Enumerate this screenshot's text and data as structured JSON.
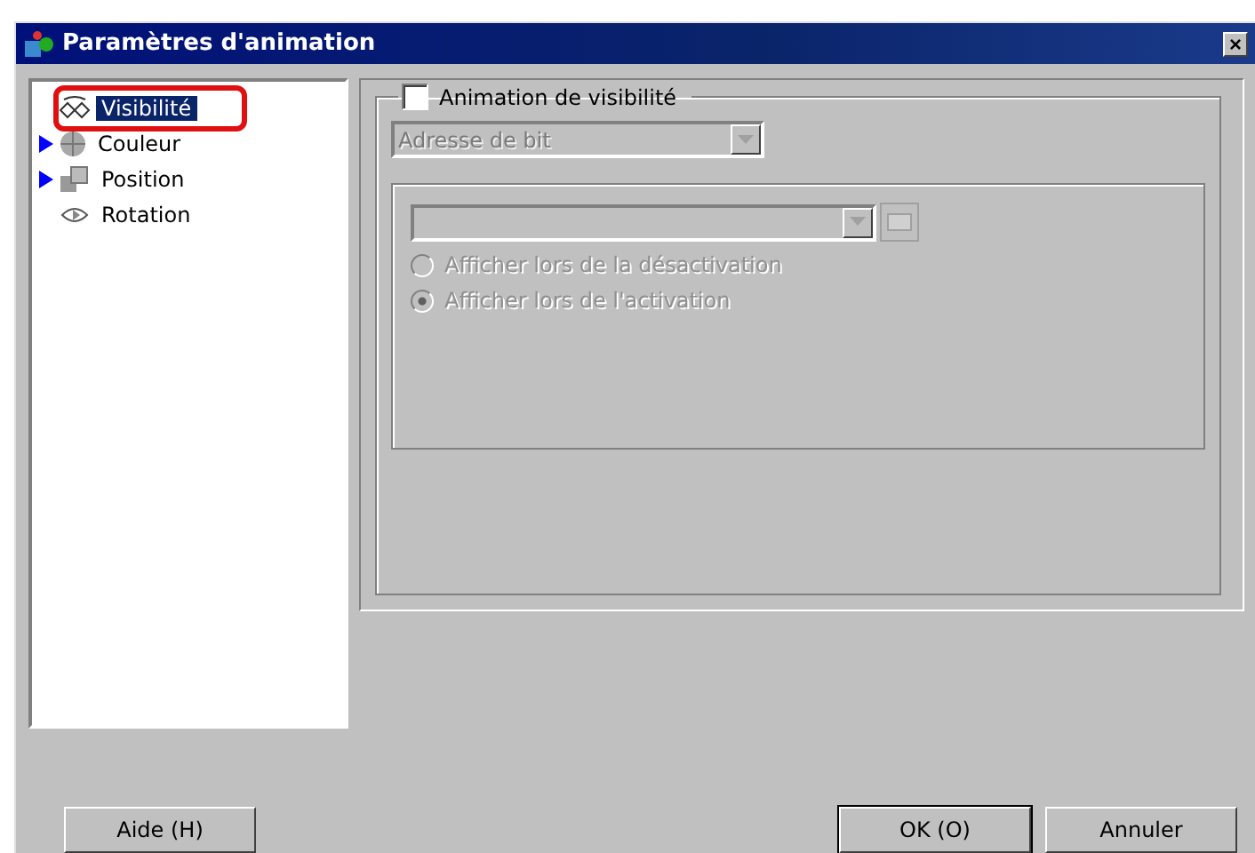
{
  "window": {
    "title": "Paramètres d'animation",
    "close": "×"
  },
  "tree": {
    "items": [
      {
        "label": "Visibilité",
        "selected": true,
        "expandable": false,
        "highlighted": true
      },
      {
        "label": "Couleur",
        "selected": false,
        "expandable": true,
        "highlighted": false
      },
      {
        "label": "Position",
        "selected": false,
        "expandable": true,
        "highlighted": false
      },
      {
        "label": "Rotation",
        "selected": false,
        "expandable": false,
        "highlighted": false
      }
    ]
  },
  "panel": {
    "checkbox": {
      "label": "Animation de visibilité",
      "checked": false
    },
    "address_type": {
      "value": "Adresse de bit",
      "disabled": true
    },
    "address": {
      "disabled": true
    },
    "options": [
      {
        "label": "Afficher lors de la désactivation",
        "selected": false,
        "disabled": true
      },
      {
        "label": "Afficher lors de l'activation",
        "selected": true,
        "disabled": true
      }
    ]
  },
  "buttons": {
    "help": "Aide (H)",
    "ok": "OK (O)",
    "cancel": "Annuler"
  }
}
